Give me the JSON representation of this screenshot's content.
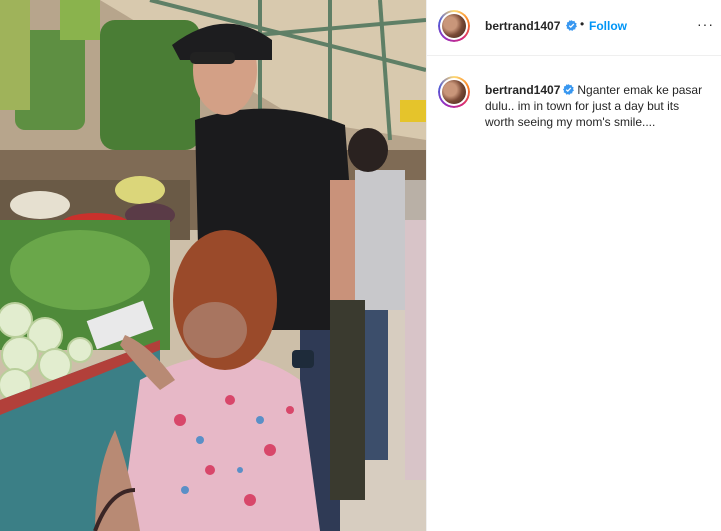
{
  "post": {
    "photo_alt": "",
    "author": {
      "username": "bertrand1407",
      "verified": true,
      "avatar_icon": "profile-avatar"
    },
    "header": {
      "separator": "•",
      "follow_label": "Follow",
      "more_label": "···"
    },
    "caption": {
      "username": "bertrand1407",
      "text": "Nganter emak ke pasar dulu.. im in town for just a day but its worth seeing my mom's smile...."
    },
    "colors": {
      "follow": "#0095f6",
      "verified": "#3897f0",
      "text": "#262626",
      "divider": "#efefef"
    }
  }
}
